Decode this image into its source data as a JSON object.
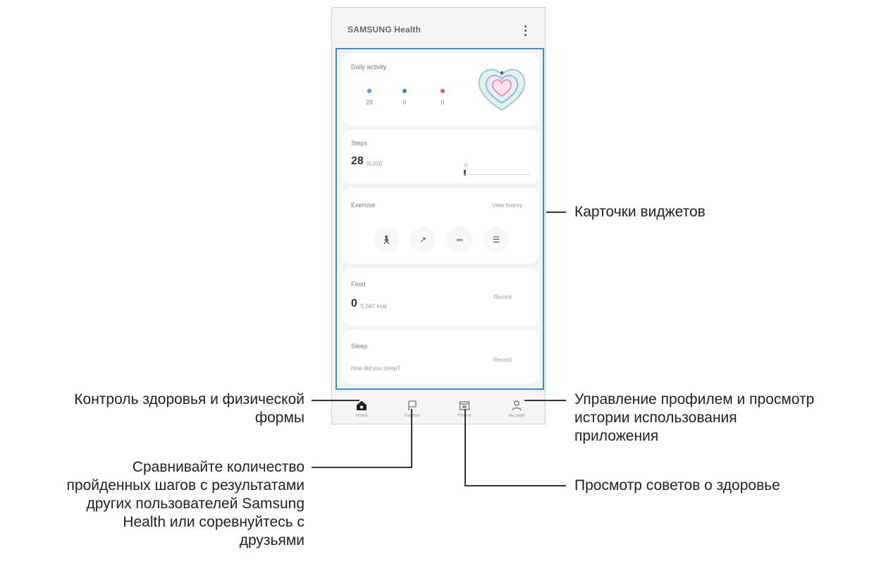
{
  "app": {
    "title": "SAMSUNG Health"
  },
  "daily_activity": {
    "title": "Daily activity",
    "items": [
      {
        "icon": "walk-icon",
        "value": "28",
        "color": "#4aa3d8"
      },
      {
        "icon": "flame-icon",
        "value": "0",
        "color": "#3a7fbf"
      },
      {
        "icon": "heart-rate-icon",
        "value": "0",
        "color": "#e0507a"
      }
    ]
  },
  "steps": {
    "title": "Steps",
    "value": "28",
    "unit": "/6,000",
    "goal_marker": "0"
  },
  "exercise": {
    "title": "Exercise",
    "link": "View history",
    "icons": [
      "walking-icon",
      "running-icon",
      "treadmill-icon",
      "list-icon"
    ]
  },
  "food": {
    "title": "Food",
    "value": "0",
    "unit": "/1,567 kcal",
    "action": "Record"
  },
  "sleep": {
    "title": "Sleep",
    "prompt": "How did you sleep?",
    "action": "Record"
  },
  "nav": [
    {
      "label": "Home",
      "icon": "home-icon"
    },
    {
      "label": "Together",
      "icon": "flag-icon"
    },
    {
      "label": "Fitness",
      "icon": "fitness-icon"
    },
    {
      "label": "My page",
      "icon": "profile-icon"
    }
  ],
  "annotations": {
    "widgets": "Карточки виджетов",
    "home_line1": "Контроль здоровья и физической",
    "home_line2": "формы",
    "profile_line1": "Управление профилем и просмотр",
    "profile_line2": "истории использования",
    "profile_line3": "приложения",
    "together_line1": "Сравнивайте количество",
    "together_line2": "пройденных шагов с результатами",
    "together_line3": "других пользователей Samsung",
    "together_line4": "Health или соревнуйтесь с",
    "together_line5": "друзьями",
    "fitness": "Просмотр советов о здоровье"
  },
  "colors": {
    "highlight": "#2f93d6",
    "annotation_line": "#333333"
  }
}
